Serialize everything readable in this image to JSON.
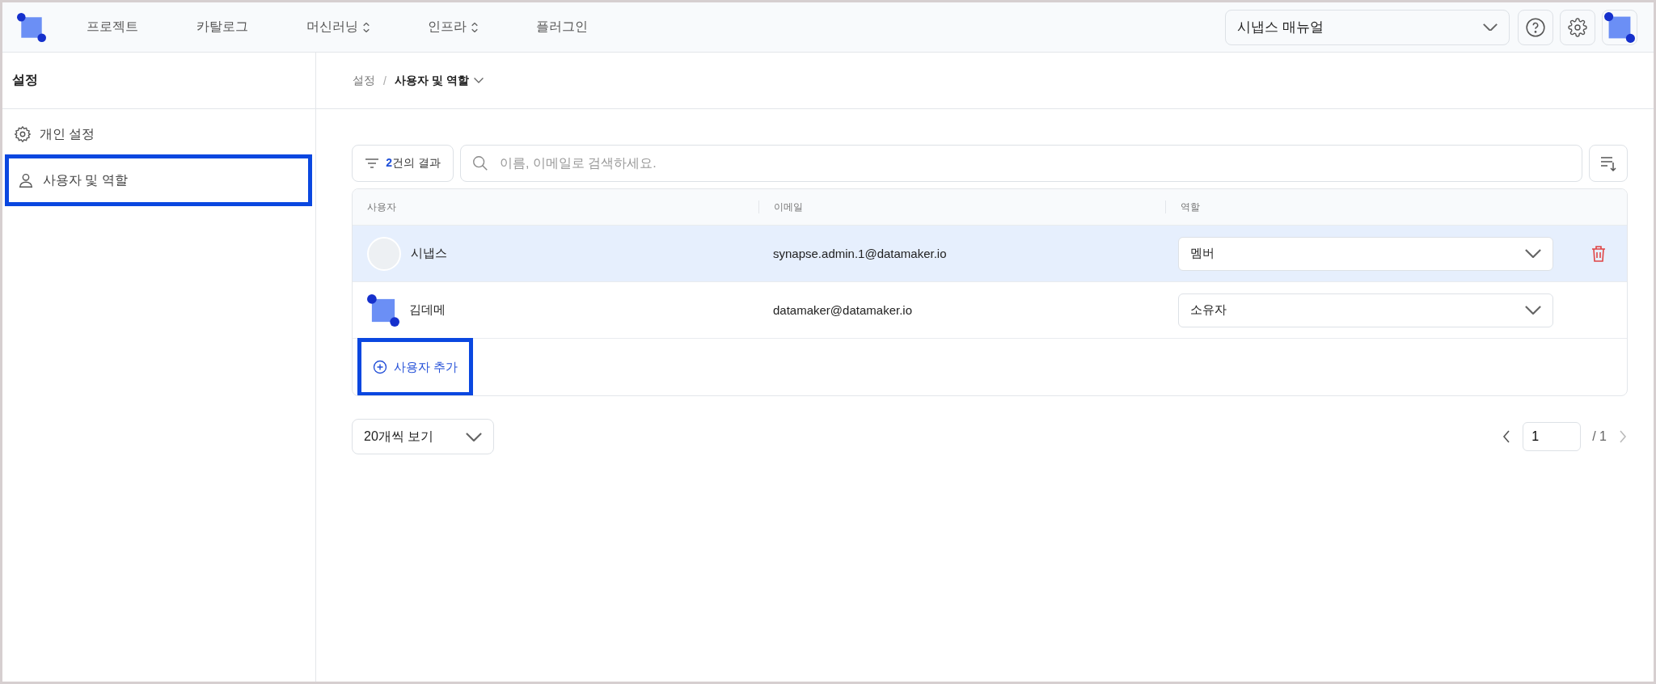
{
  "nav": {
    "items": [
      {
        "label": "프로젝트",
        "dropdown": false
      },
      {
        "label": "카탈로그",
        "dropdown": false
      },
      {
        "label": "머신러닝",
        "dropdown": true
      },
      {
        "label": "인프라",
        "dropdown": true
      },
      {
        "label": "플러그인",
        "dropdown": false
      }
    ]
  },
  "workspace_select": {
    "value": "시냅스 매뉴얼"
  },
  "sidebar": {
    "title": "설정",
    "items": [
      {
        "label": "개인 설정",
        "highlighted": false
      },
      {
        "label": "사용자 및 역할",
        "highlighted": true
      }
    ]
  },
  "breadcrumb": {
    "separator": "/",
    "items": [
      {
        "label": "설정",
        "current": false
      },
      {
        "label": "사용자 및 역할",
        "current": true
      }
    ]
  },
  "filter_button": {
    "count": "2",
    "label": "건의 결과"
  },
  "search": {
    "placeholder": "이름, 이메일로 검색하세요."
  },
  "table": {
    "columns": [
      "사용자",
      "이메일",
      "역할"
    ],
    "rows": [
      {
        "name": "시냅스",
        "email": "synapse.admin.1@datamaker.io",
        "role": "멤버",
        "kind": "blank",
        "selected": true
      },
      {
        "name": "김데메",
        "email": "datamaker@datamaker.io",
        "role": "소유자",
        "kind": "logo",
        "selected": false
      }
    ]
  },
  "add_user": {
    "label": "사용자 추가",
    "highlighted": true
  },
  "per_page": {
    "value": "20개씩 보기"
  },
  "pagination": {
    "page": "1",
    "total": "/ 1"
  }
}
